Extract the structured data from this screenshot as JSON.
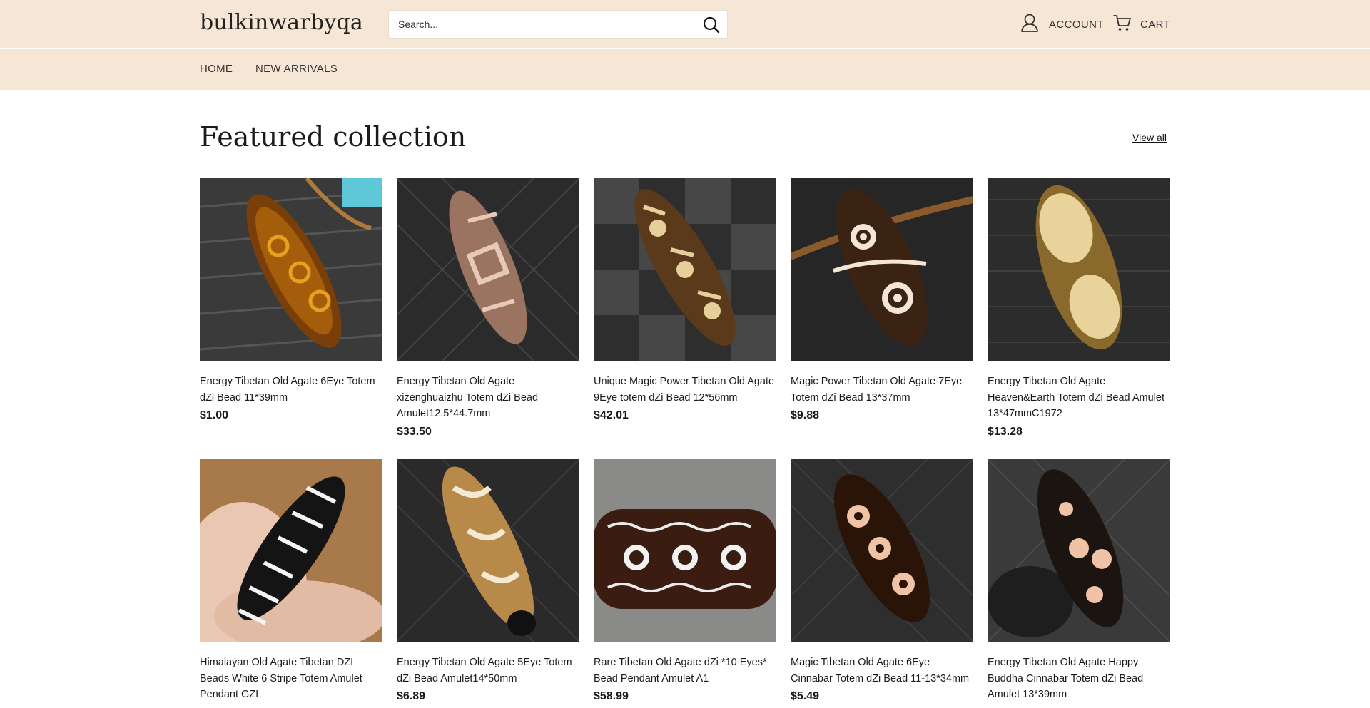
{
  "header": {
    "logo": "bulkinwarbyqa",
    "search_placeholder": "Search...",
    "account_label": "ACCOUNT",
    "cart_label": "CART"
  },
  "nav": {
    "items": [
      "HOME",
      "NEW ARRIVALS"
    ]
  },
  "featured": {
    "title": "Featured collection",
    "view_all": "View all"
  },
  "products": [
    {
      "name": "Energy Tibetan Old Agate 6Eye Totem dZi Bead 11*39mm",
      "price": "$1.00"
    },
    {
      "name": "Energy Tibetan Old Agate xizenghuaizhu Totem dZi Bead Amulet12.5*44.7mm",
      "price": "$33.50"
    },
    {
      "name": "Unique Magic Power Tibetan Old Agate 9Eye totem dZi Bead 12*56mm",
      "price": "$42.01"
    },
    {
      "name": "Magic Power Tibetan Old Agate 7Eye Totem dZi Bead 13*37mm",
      "price": "$9.88"
    },
    {
      "name": "Energy Tibetan Old Agate Heaven&Earth Totem dZi Bead Amulet 13*47mmC1972",
      "price": "$13.28"
    },
    {
      "name": "Himalayan Old Agate Tibetan DZI Beads White 6 Stripe Totem Amulet Pendant GZI",
      "price": ""
    },
    {
      "name": "Energy Tibetan Old Agate 5Eye Totem dZi Bead Amulet14*50mm",
      "price": "$6.89"
    },
    {
      "name": "Rare Tibetan Old Agate dZi *10 Eyes* Bead Pendant Amulet A1",
      "price": "$58.99"
    },
    {
      "name": "Magic Tibetan Old Agate 6Eye Cinnabar Totem dZi Bead 11-13*34mm",
      "price": "$5.49"
    },
    {
      "name": "Energy Tibetan Old Agate Happy Buddha Cinnabar Totem dZi Bead Amulet 13*39mm",
      "price": ""
    }
  ],
  "colors": {
    "header_bg": "#f6e6d6",
    "text": "#1a1a1a"
  },
  "icons": [
    "search-icon",
    "account-icon",
    "cart-icon"
  ]
}
